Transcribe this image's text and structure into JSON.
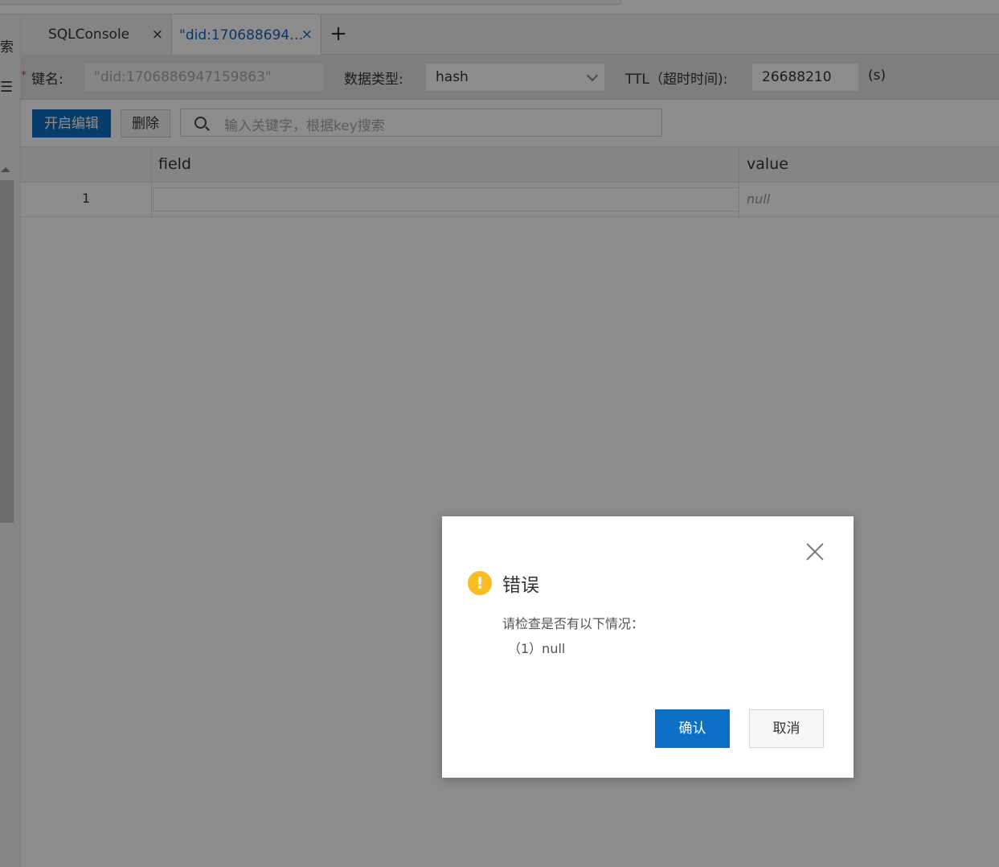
{
  "sidebar": {
    "search_label": "索",
    "menu_icon": "menu-icon"
  },
  "tabs": [
    {
      "label": "SQLConsole",
      "close": "×",
      "active": false
    },
    {
      "label": "\"did:170688694…",
      "close": "×",
      "active": true
    }
  ],
  "tab_add_label": "+",
  "key_form": {
    "required_mark": "*",
    "key_label": "键名:",
    "key_value": "\"did:1706886947159863\"",
    "type_label": "数据类型:",
    "type_value": "hash",
    "ttl_label": "TTL（超时时间):",
    "ttl_value": "26688210",
    "ttl_unit": "(s)"
  },
  "toolbar": {
    "edit_label": "开启编辑",
    "delete_label": "删除",
    "search_placeholder": "输入关键字，根据key搜索"
  },
  "table": {
    "headers": {
      "field": "field",
      "value": "value"
    },
    "rows": [
      {
        "index": "1",
        "field": "",
        "value": "null"
      }
    ]
  },
  "dialog": {
    "title": "错误",
    "icon": "warning-icon",
    "message": "请检查是否有以下情况：",
    "detail": "（1）null",
    "ok_label": "确认",
    "cancel_label": "取消"
  },
  "colors": {
    "primary": "#0c70c6",
    "active_tab_text": "#1565c0",
    "warning": "#fbbd24",
    "required": "#e53935"
  }
}
